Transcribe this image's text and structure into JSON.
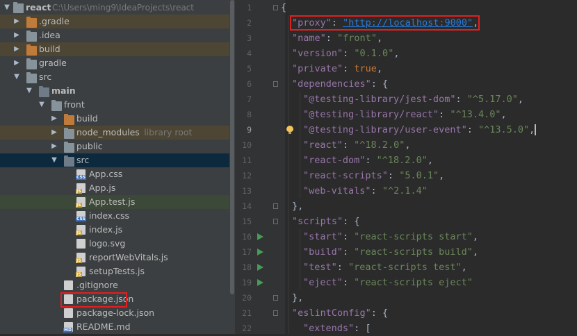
{
  "project_tree": {
    "root": {
      "name": "react",
      "path": "C:\\Users\\ming9\\IdeaProjects\\react"
    },
    "items": [
      {
        "label": ".gradle",
        "badge": ""
      },
      {
        "label": ".idea",
        "badge": ""
      },
      {
        "label": "build",
        "badge": ""
      },
      {
        "label": "gradle",
        "badge": ""
      },
      {
        "label": "src",
        "badge": ""
      },
      {
        "label": "main",
        "badge": ""
      },
      {
        "label": "front",
        "badge": ""
      },
      {
        "label": "build",
        "badge": ""
      },
      {
        "label": "node_modules",
        "hint": "library root",
        "badge": ""
      },
      {
        "label": "public",
        "badge": ""
      },
      {
        "label": "src",
        "badge": ""
      },
      {
        "label": "App.css",
        "badge": "CSS"
      },
      {
        "label": "App.js",
        "badge": "JS"
      },
      {
        "label": "App.test.js",
        "badge": "JS"
      },
      {
        "label": "index.css",
        "badge": "CSS"
      },
      {
        "label": "index.js",
        "badge": "JS"
      },
      {
        "label": "logo.svg",
        "badge": ""
      },
      {
        "label": "reportWebVitals.js",
        "badge": "JS"
      },
      {
        "label": "setupTests.js",
        "badge": "JS"
      },
      {
        "label": ".gitignore",
        "badge": ""
      },
      {
        "label": "package.json",
        "badge": ""
      },
      {
        "label": "package-lock.json",
        "badge": ""
      },
      {
        "label": "README.md",
        "badge": "MD"
      }
    ]
  },
  "editor": {
    "line_numbers": [
      "1",
      "2",
      "3",
      "4",
      "5",
      "6",
      "7",
      "8",
      "9",
      "10",
      "11",
      "12",
      "13",
      "14",
      "15",
      "16",
      "17",
      "18",
      "19",
      "20",
      "21",
      "22"
    ],
    "current_line": "9",
    "lines": [
      {
        "t": "{"
      },
      {
        "key": "\"proxy\"",
        "url": "\"http://localhost:9000\"",
        "end": ","
      },
      {
        "key": "\"name\"",
        "val": "\"front\"",
        "end": ","
      },
      {
        "key": "\"version\"",
        "val": "\"0.1.0\"",
        "end": ","
      },
      {
        "key": "\"private\"",
        "kw": "true",
        "end": ","
      },
      {
        "key": "\"dependencies\"",
        "end": ": {"
      },
      {
        "key": "\"@testing-library/jest-dom\"",
        "val": "\"^5.17.0\"",
        "end": ","
      },
      {
        "key": "\"@testing-library/react\"",
        "val": "\"^13.4.0\"",
        "end": ","
      },
      {
        "key": "\"@testing-library/user-event\"",
        "val": "\"^13.5.0\"",
        "end": ","
      },
      {
        "key": "\"react\"",
        "val": "\"^18.2.0\"",
        "end": ","
      },
      {
        "key": "\"react-dom\"",
        "val": "\"^18.2.0\"",
        "end": ","
      },
      {
        "key": "\"react-scripts\"",
        "val": "\"5.0.1\"",
        "end": ","
      },
      {
        "key": "\"web-vitals\"",
        "val": "\"^2.1.4\"",
        "end": ""
      },
      {
        "t": "},"
      },
      {
        "key": "\"scripts\"",
        "end": ": {"
      },
      {
        "key": "\"start\"",
        "val": "\"react-scripts start\"",
        "end": ","
      },
      {
        "key": "\"build\"",
        "val": "\"react-scripts build\"",
        "end": ","
      },
      {
        "key": "\"test\"",
        "val": "\"react-scripts test\"",
        "end": ","
      },
      {
        "key": "\"eject\"",
        "val": "\"react-scripts eject\"",
        "end": ""
      },
      {
        "t": "},"
      },
      {
        "key": "\"eslintConfig\"",
        "end": ": {"
      },
      {
        "key": "\"extends\"",
        "end": ": ["
      }
    ]
  }
}
